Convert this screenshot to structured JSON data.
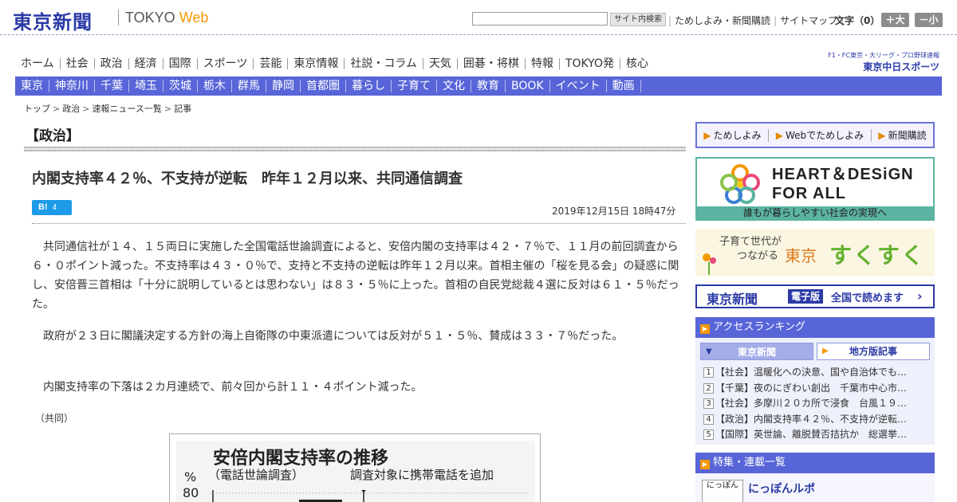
{
  "header": {
    "logo": "東京新聞",
    "tokyo": "TOKYO",
    "web": "Web",
    "search_placeholder": "",
    "search_button": "サイト内検索",
    "top_links": [
      "ためしよみ・新聞購読",
      "サイトマップ"
    ],
    "font_size_label": "文字（0）",
    "font_bigger": "＋大",
    "font_smaller": "－小"
  },
  "main_nav": [
    "ホーム",
    "社会",
    "政治",
    "経済",
    "国際",
    "スポーツ",
    "芸能",
    "東京情報",
    "社説・コラム",
    "天気",
    "囲碁・将棋",
    "特報",
    "TOKYO発",
    "核心"
  ],
  "chunichi": {
    "top": "F1・FC東京・大リーグ・プロ野球速報",
    "brand": "東京中日スポーツ"
  },
  "region_nav": [
    "東京",
    "神奈川",
    "千葉",
    "埼玉",
    "茨城",
    "栃木",
    "群馬",
    "静岡",
    "首都圏",
    "暮らし",
    "子育て",
    "文化",
    "教育",
    "BOOK",
    "イベント",
    "動画"
  ],
  "breadcrumb": [
    "トップ",
    "政治",
    "速報ニュース一覧",
    "記事"
  ],
  "article": {
    "section": "【政治】",
    "headline": "内閣支持率４２％、不支持が逆転　昨年１２月以来、共同通信調査",
    "hatebu_label": "B!",
    "hatebu_count": "4",
    "timestamp": "2019年12月15日 18時47分",
    "paragraphs": [
      "共同通信社が１４、１５両日に実施した全国電話世論調査によると、安倍内閣の支持率は４２・７％で、１１月の前回調査から６・０ポイント減った。不支持率は４３・０％で、支持と不支持の逆転は昨年１２月以来。首相主催の「桜を見る会」の疑惑に関し、安倍晋三首相は「十分に説明しているとは思わない」は８３・５％に上った。首相の自民党総裁４選に反対は６１・５％だった。",
      "政府が２３日に閣議決定する方針の海上自衛隊の中東派遣については反対が５１・５％、賛成は３３・７％だった。",
      "内閣支持率の下落は２カ月連続で、前々回から計１１・４ポイント減った。"
    ],
    "credit": "（共同）",
    "figure": {
      "title": "安倍内閣支持率の推移",
      "subtitle": "（電話世論調査）",
      "note": "調査対象に携帯電話を追加",
      "unit": "%",
      "tick": "80"
    }
  },
  "sidebar": {
    "trial_links": [
      "ためしよみ",
      "Webでためしよみ",
      "新聞購読"
    ],
    "hd_title_1": "HEART＆DESiGN",
    "hd_title_2": "FOR ALL",
    "hd_sub": "誰もが暮らしやすい社会の実現へ",
    "suku_left_1": "子育て世代が",
    "suku_left_2": "つながる",
    "suku_tokyo": "東京",
    "suku_name": "すくすく",
    "edition_logo": "東京新聞",
    "edition_tag": "電子版",
    "edition_text": "全国で読めます",
    "ranking_head": "アクセスランキング",
    "ranking_tab1": "東京新聞",
    "ranking_tab2": "地方版記事",
    "ranking": [
      "【社会】温暖化への決意、国や自治体でも…",
      "【千葉】夜のにぎわい創出　千葉市中心市…",
      "【社会】多摩川２０カ所で浸食　台風１９…",
      "【政治】内閣支持率４２％、不支持が逆転…",
      "【国際】英世論、離脱賛否拮抗か　総選挙…"
    ],
    "feature_head": "特集・連載一覧",
    "feature_thumb": "にっぽん",
    "feature_title": "にっぽんルポ"
  },
  "colors": {
    "brand_blue": "#2b3aa6",
    "nav_blue": "#5865d8",
    "accent_orange": "#f39800"
  }
}
